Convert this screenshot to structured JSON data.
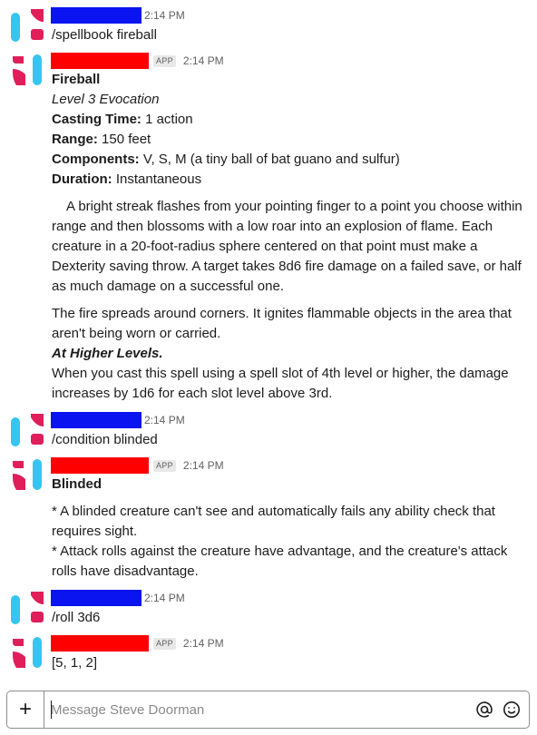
{
  "messages": [
    {
      "type": "user",
      "time": "2:14 PM",
      "text": "/spellbook fireball"
    },
    {
      "type": "bot",
      "badge": "APP",
      "time": "2:14 PM",
      "spell": {
        "name": "Fireball",
        "level": "Level 3 Evocation",
        "casting_time_label": "Casting Time:",
        "casting_time": " 1 action",
        "range_label": "Range:",
        "range": " 150 feet",
        "components_label": "Components:",
        "components": " V, S, M (a tiny ball of bat guano and sulfur)",
        "duration_label": "Duration:",
        "duration": " Instantaneous",
        "description_1": "A bright streak flashes from your pointing finger to a point you choose within range and then blossoms with a low roar into an explosion of flame. Each creature in a 20-foot-radius sphere centered on that point must make a Dexterity saving throw. A target takes 8d6 fire damage on a failed save, or half as much damage on a successful one.",
        "description_2": "The fire spreads around corners. It ignites flammable objects in the area that aren't being worn or carried.",
        "higher_levels_label": "At Higher Levels.",
        "higher_levels": "When you cast this spell using a spell slot of 4th level or higher, the damage increases by 1d6 for each slot level above 3rd."
      }
    },
    {
      "type": "user",
      "time": "2:14 PM",
      "text": "/condition blinded"
    },
    {
      "type": "bot",
      "badge": "APP",
      "time": "2:14 PM",
      "condition": {
        "name": "Blinded",
        "line_1": "* A blinded creature can't see and automatically fails any ability check that requires sight.",
        "line_2": "* Attack rolls against the creature have advantage, and the creature's attack rolls have disadvantage."
      }
    },
    {
      "type": "user",
      "time": "2:14 PM",
      "text": "/roll 3d6"
    },
    {
      "type": "bot",
      "badge": "APP",
      "time": "2:14 PM",
      "text": "[5, 1, 2]"
    }
  ],
  "composer": {
    "plus_label": "+",
    "placeholder": "Message Steve Doorman"
  },
  "icons": {
    "avatar": "slack-logo-icon",
    "add": "plus-icon",
    "mention": "at-sign-icon",
    "emoji": "emoji-smiley-icon"
  },
  "colors": {
    "redacted_user": "#0a14f0",
    "redacted_bot": "#ff0000",
    "logo_blue": "#36c5f0",
    "logo_red": "#e01e5a"
  }
}
